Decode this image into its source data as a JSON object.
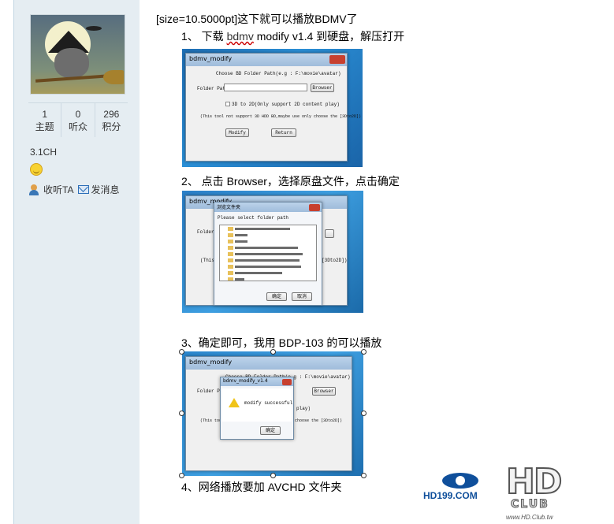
{
  "user": {
    "stats": [
      {
        "num": "1",
        "label": "主题"
      },
      {
        "num": "0",
        "label": "听众"
      },
      {
        "num": "296",
        "label": "积分"
      }
    ],
    "group": "3.1CH",
    "follow_label": "收听TA",
    "message_label": "发消息"
  },
  "post": {
    "line0": "[size=10.5000pt]这下就可以播放BDMV了",
    "step1_prefix": "1、 下载 ",
    "step1_link": "bdmv",
    "step1_suffix": " modify v1.4 到硬盘，解压打开",
    "step2": "2、 点击 Browser，选择原盘文件，点击确定",
    "step3": "3、确定即可，我用 BDP-103 的可以播放",
    "step4": "4、网络播放要加 AVCHD 文件夹"
  },
  "screenshot1": {
    "title": "bdmv_modify",
    "prompt": "Choose BD Folder Path(e.g  : F:\\movie\\avatar)",
    "folder_label": "Folder Path:",
    "browse": "Browser",
    "checkbox": "3D to 2D(Only support 2D content play)",
    "note": "(This tool not support 3D HDD BD,maybe use only choose the [3Dto2D])",
    "modify": "Modify",
    "return": "Return"
  },
  "screenshot2": {
    "title": "bdmv_modify",
    "dialog_title": "浏览文件夹",
    "dialog_prompt": "Please select folder path",
    "folder_label": "Folder Path:",
    "note_start": "(This",
    "note_end": "[3Dto2D])",
    "ok": "确定",
    "cancel": "取消"
  },
  "screenshot3": {
    "title": "bdmv_modify",
    "prompt": "Choose BD Folder Path(e.g  : F:\\movie\\avatar)",
    "folder_label": "Folder Path:",
    "browse": "Browser",
    "note_start": "(This tool not support 3D HDD BD,",
    "note_end": "choose the [3Dto2D])",
    "play": "play)",
    "dialog_title": "bdmv_modify_v1.4",
    "dialog_msg": "modify successful",
    "ok": "确定"
  },
  "logos": {
    "hd199": "HD199.COM",
    "hd": "HD",
    "club": "CLUB",
    "url": "www.HD.Club.tw"
  }
}
